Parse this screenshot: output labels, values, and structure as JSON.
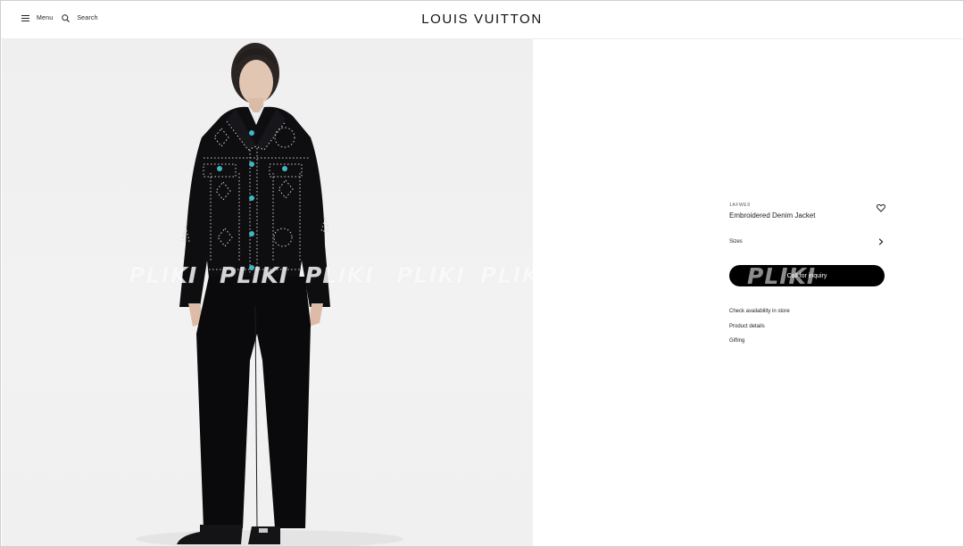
{
  "header": {
    "menu_label": "Menu",
    "search_label": "Search",
    "brand": "LOUIS VUITTON",
    "menu_icon": "hamburger-icon",
    "search_icon": "search-icon"
  },
  "gallery": {
    "watermarks": [
      "PLIKI",
      "PLIKI",
      "PLIKI",
      "PLIKI",
      "PLIKI"
    ]
  },
  "product": {
    "sku": "1AFWE9",
    "title": "Embroidered Denim Jacket",
    "wishlist_icon": "heart-icon",
    "sizes_label": "Sizes",
    "sizes_icon": "chevron-right-icon",
    "cta_label": "Call for inquiry",
    "cta_watermark": "PLIKI",
    "links": [
      "Check availability in store",
      "Product details",
      "Gifting"
    ]
  },
  "colors": {
    "cta_background": "#000000",
    "image_background": "#efefef",
    "jacket": "#0d0d0f",
    "button_turquoise": "#3fb7c2"
  }
}
